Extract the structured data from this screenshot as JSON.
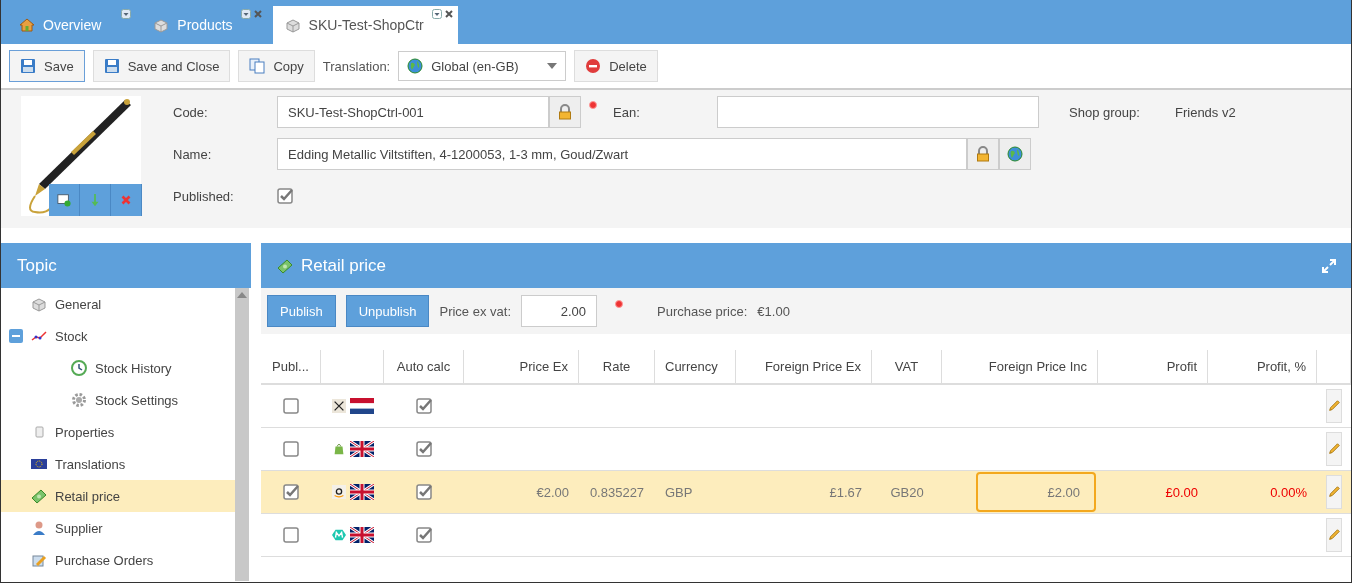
{
  "tabs": [
    {
      "label": "Overview",
      "kind": "home",
      "selected": false,
      "closable": false
    },
    {
      "label": "Products",
      "kind": "brick",
      "selected": false,
      "closable": true
    },
    {
      "label": "SKU-Test-ShopCtr",
      "kind": "brick",
      "selected": true,
      "closable": true
    }
  ],
  "toolbar": {
    "buttons": [
      {
        "label": "Save",
        "kind": "save",
        "focused": true
      },
      {
        "label": "Save and Close",
        "kind": "save",
        "focused": false
      },
      {
        "label": "Copy",
        "kind": "copy",
        "focused": false
      }
    ],
    "translation": {
      "label": "Translation:",
      "value": "Global (en-GB)"
    },
    "delete": {
      "label": "Delete"
    }
  },
  "form": {
    "code": {
      "label": "Code:",
      "value": "SKU-Test-ShopCtrl-001"
    },
    "ean": {
      "label": "Ean:"
    },
    "shop_group": {
      "label": "Shop group:",
      "value": "Friends v2"
    },
    "name": {
      "label": "Name:",
      "value": "Edding Metallic Viltstiften, 4-1200053, 1-3 mm, Goud/Zwart"
    },
    "published": {
      "label": "Published:",
      "checked": true
    }
  },
  "sidebar": {
    "title": "Topic",
    "items": [
      {
        "label": "General",
        "kind": "brick",
        "selected": false
      },
      {
        "label": "Stock",
        "kind": "chart",
        "selected": false,
        "expanded": true,
        "children": [
          {
            "label": "Stock History",
            "kind": "clock",
            "selected": false
          },
          {
            "label": "Stock Settings",
            "kind": "gear",
            "selected": false
          }
        ]
      },
      {
        "label": "Properties",
        "kind": "doc",
        "selected": false
      },
      {
        "label": "Translations",
        "kind": "eu",
        "selected": false
      },
      {
        "label": "Retail price",
        "kind": "money",
        "selected": true
      },
      {
        "label": "Supplier",
        "kind": "person",
        "selected": false
      },
      {
        "label": "Purchase Orders",
        "kind": "order",
        "selected": false
      }
    ]
  },
  "panel": {
    "title": "Retail price",
    "actions": [
      "Publish",
      "Unpublish"
    ],
    "price_ex_vat": {
      "label": "Price ex vat:",
      "value": "2.00"
    },
    "purchase_price": {
      "label": "Purchase price:",
      "value": "€1.00"
    },
    "table": {
      "columns": [
        "Publ...",
        "",
        "Auto calc",
        "Price Ex",
        "Rate",
        "Currency",
        "Foreign Price Ex",
        "VAT",
        "Foreign Price Inc",
        "Profit",
        "Profit, %"
      ],
      "rows": [
        {
          "published": false,
          "kind": "cross_nl",
          "auto_calc": true,
          "selected": false
        },
        {
          "published": false,
          "kind": "bag_gb",
          "auto_calc": true,
          "selected": false
        },
        {
          "published": true,
          "kind": "smile_gb",
          "auto_calc": true,
          "selected": true,
          "price_ex": "€2.00",
          "rate": "0.835227",
          "currency": "GBP",
          "foreign_price_ex": "£1.67",
          "vat": "GB20",
          "foreign_price_inc": "£2.00",
          "foreign_price_inc_focused": true,
          "profit": "£0.00",
          "profit_pct": "0.00%",
          "profit_alert": true
        },
        {
          "published": false,
          "kind": "m_gb",
          "auto_calc": true,
          "selected": false
        }
      ]
    }
  }
}
